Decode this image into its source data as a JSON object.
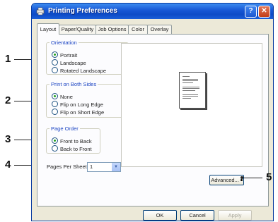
{
  "window": {
    "title": "Printing Preferences",
    "help_glyph": "?",
    "close_glyph": "✕"
  },
  "tabs": [
    "Layout",
    "Paper/Quality",
    "Job Options",
    "Color",
    "Overlay"
  ],
  "orientation": {
    "legend": "Orientation",
    "options": [
      {
        "label": "Portrait",
        "selected": true
      },
      {
        "label": "Landscape",
        "selected": false
      },
      {
        "label": "Rotated Landscape",
        "selected": false
      }
    ]
  },
  "print_both_sides": {
    "legend": "Print on Both Sides",
    "options": [
      {
        "label": "None",
        "selected": true
      },
      {
        "label": "Flip on Long Edge",
        "selected": false
      },
      {
        "label": "Flip on Short Edge",
        "selected": false
      }
    ]
  },
  "page_order": {
    "legend": "Page Order",
    "options": [
      {
        "label": "Front to Back",
        "selected": true
      },
      {
        "label": "Back to Front",
        "selected": false
      }
    ]
  },
  "pages_per_sheet": {
    "label": "Pages Per Sheet:",
    "value": "1"
  },
  "buttons": {
    "advanced": "Advanced...",
    "ok": "OK",
    "cancel": "Cancel",
    "apply": "Apply"
  },
  "callouts": [
    "1",
    "2",
    "3",
    "4",
    "5"
  ],
  "colors": {
    "titlebar": "#0d4bc7",
    "group_legend": "#1c45c3",
    "radio_dot": "#21a121"
  }
}
